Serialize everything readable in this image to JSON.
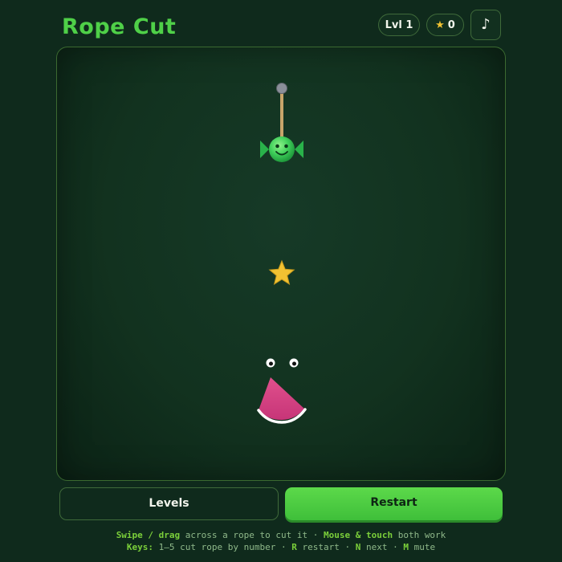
{
  "header": {
    "title": "Rope Cut",
    "level_label": "Lvl 1",
    "stars_icon": "★",
    "stars_count": "0",
    "music_icon": "♪"
  },
  "game": {
    "ropes": [
      {
        "id": 1,
        "status": "intact"
      }
    ],
    "candy": {
      "face": "smiling"
    },
    "stars_on_board": 1,
    "monster": {
      "mouth": "open"
    }
  },
  "buttons": {
    "levels": "Levels",
    "restart": "Restart"
  },
  "help": {
    "line1": {
      "k1": "Swipe / drag",
      "t1": " across a rope to cut it · ",
      "k2": "Mouse & touch",
      "t2": " both work"
    },
    "line2": {
      "k1": "Keys:",
      "t1": " 1–5 cut rope by number · ",
      "k2": "R",
      "t2": " restart · ",
      "k3": "N",
      "t3": " next · ",
      "k4": "M",
      "t4": " mute"
    }
  },
  "colors": {
    "accent": "#4fd048",
    "background": "#0f2a1c",
    "star": "#f1c232",
    "monster_pink": "#e0508c"
  }
}
